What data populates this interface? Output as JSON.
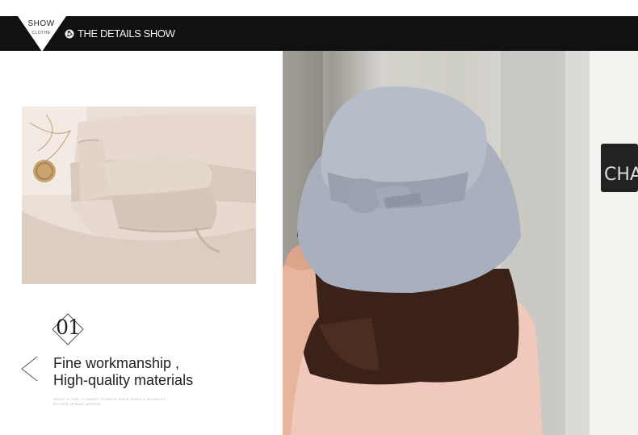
{
  "header": {
    "badge_top": "SHOW",
    "badge_bottom": "CLOTHE",
    "title": "THE DETAILS SHOW",
    "icon": "camera-aperture-icon"
  },
  "main_photo": {
    "sign_text": "CHA"
  },
  "feature": {
    "number": "01",
    "line1": "Fine workmanship ,",
    "line2": "High-quality materials",
    "fine_print": "WHAT IS THE COMPANY PURSUE HAVE MAKE A SLIGHTLY BIGGER AFRAID APPEAR",
    "nav_icon": "chevron-left-icon"
  },
  "colors": {
    "header_bg": "#111111",
    "hat_color": "#a9b0bd",
    "top_color": "#f0c8bc",
    "hair_color": "#3a2218"
  }
}
